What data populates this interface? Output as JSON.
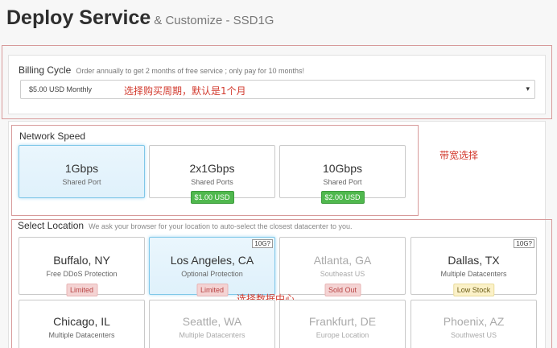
{
  "header": {
    "title": "Deploy Service",
    "subtitle": "& Customize - SSD1G"
  },
  "billing": {
    "label": "Billing Cycle",
    "note": "Order annually to get 2 months of free service ; only pay for 10 months!",
    "selected": "$5.00 USD Monthly",
    "annotation": "选择购买周期，默认是1个月"
  },
  "network": {
    "label": "Network Speed",
    "annotation": "带宽选择",
    "options": [
      {
        "title": "1Gbps",
        "subtitle": "Shared Port",
        "badge": ""
      },
      {
        "title": "2x1Gbps",
        "subtitle": "Shared Ports",
        "badge": "$1.00 USD"
      },
      {
        "title": "10Gbps",
        "subtitle": "Shared Port",
        "badge": "$2.00 USD"
      }
    ]
  },
  "location": {
    "label": "Select Location",
    "note": "We ask your browser for your location to auto-select the closest datacenter to you.",
    "annotation": "选择数据中心",
    "cards": [
      {
        "title": "Buffalo, NY",
        "subtitle": "Free DDoS Protection",
        "badge": "Limited",
        "tag": ""
      },
      {
        "title": "Los Angeles, CA",
        "subtitle": "Optional Protection",
        "badge": "Limited",
        "tag": "10G?"
      },
      {
        "title": "Atlanta, GA",
        "subtitle": "Southeast US",
        "badge": "Sold Out",
        "tag": ""
      },
      {
        "title": "Dallas, TX",
        "subtitle": "Multiple Datacenters",
        "badge": "Low Stock",
        "tag": "10G?"
      },
      {
        "title": "Chicago, IL",
        "subtitle": "Multiple Datacenters",
        "badge": "",
        "tag": ""
      },
      {
        "title": "Seattle, WA",
        "subtitle": "Multiple Datacenters",
        "badge": "",
        "tag": ""
      },
      {
        "title": "Frankfurt, DE",
        "subtitle": "Europe Location",
        "badge": "",
        "tag": ""
      },
      {
        "title": "Phoenix, AZ",
        "subtitle": "Southwest US",
        "badge": "",
        "tag": ""
      }
    ]
  },
  "icons": {
    "caret": "▾"
  },
  "colors": {
    "annotation": "#d23a2e",
    "selected_border": "#7fc7e8",
    "price_badge": "#50b84e"
  }
}
